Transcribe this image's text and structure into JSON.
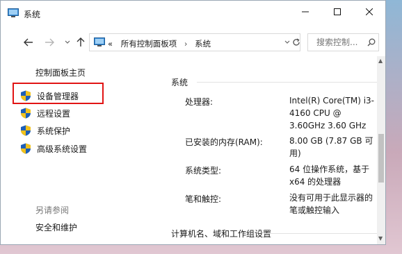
{
  "window": {
    "title": "系统",
    "controls": {
      "minimize_icon": "minimize-icon",
      "maximize_icon": "maximize-icon",
      "close_icon": "close-icon"
    }
  },
  "address_bar": {
    "overflow": "«",
    "crumbs": [
      "所有控制面板项",
      "系统"
    ],
    "separator": "›"
  },
  "search": {
    "placeholder": "搜索控制..."
  },
  "sidebar": {
    "home": "控制面板主页",
    "items": [
      {
        "label": "设备管理器",
        "icon": "uac-shield-icon"
      },
      {
        "label": "远程设置",
        "icon": "uac-shield-icon"
      },
      {
        "label": "系统保护",
        "icon": "uac-shield-icon"
      },
      {
        "label": "高级系统设置",
        "icon": "uac-shield-icon"
      }
    ],
    "see_also": "另请参阅",
    "see_also_link": "安全和维护"
  },
  "system": {
    "heading": "系统",
    "rows": [
      {
        "label": "处理器:",
        "value": "Intel(R) Core(TM) i3-4160 CPU @ 3.60GHz   3.60 GHz"
      },
      {
        "label": "已安装的内存(RAM):",
        "value": "8.00 GB (7.87 GB 可用)"
      },
      {
        "label": "系统类型:",
        "value": "64 位操作系统，基于 x64 的处理器"
      },
      {
        "label": "笔和触控:",
        "value": "没有可用于此显示器的笔或触控输入"
      }
    ],
    "section2": "计算机名、域和工作组设置"
  },
  "colors": {
    "highlight_box": "#e11414",
    "shield_blue": "#1d5fb8",
    "shield_yellow": "#f2c21b"
  }
}
